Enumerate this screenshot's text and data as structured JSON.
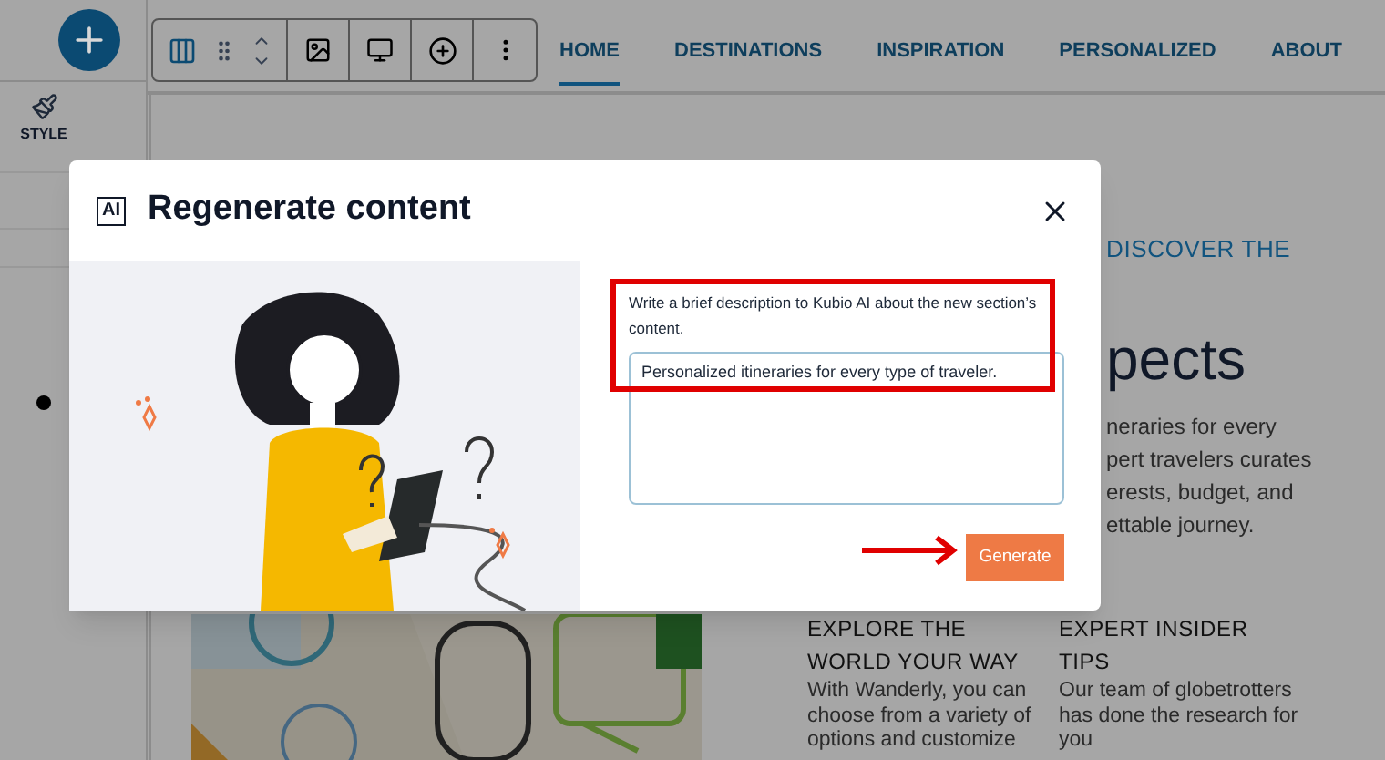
{
  "sidebar": {
    "style_label": "STYLE"
  },
  "nav": [
    {
      "label": "HOME",
      "selected": true
    },
    {
      "label": "DESTINATIONS",
      "selected": false
    },
    {
      "label": "INSPIRATION",
      "selected": false
    },
    {
      "label": "PERSONALIZED",
      "selected": false
    },
    {
      "label": "ABOUT",
      "selected": false
    }
  ],
  "page": {
    "eyebrow": "DISCOVER THE",
    "heading": "pects",
    "intro_lines": [
      "neraries for every",
      "pert travelers curates",
      "erests, budget, and",
      "ettable journey."
    ],
    "features": [
      {
        "title": "EXPLORE THE WORLD YOUR WAY",
        "body": "With Wanderly, you can choose from a variety of options and customize"
      },
      {
        "title": "EXPERT INSIDER TIPS",
        "body": "Our team of globetrotters has done the research for you"
      }
    ]
  },
  "modal": {
    "ai_badge": "AI",
    "title": "Regenerate content",
    "prompt_label": "Write a brief description to Kubio AI about the new section’s content.",
    "prompt_value": "Personalized itineraries for every type of traveler.",
    "generate_button": "Generate"
  }
}
